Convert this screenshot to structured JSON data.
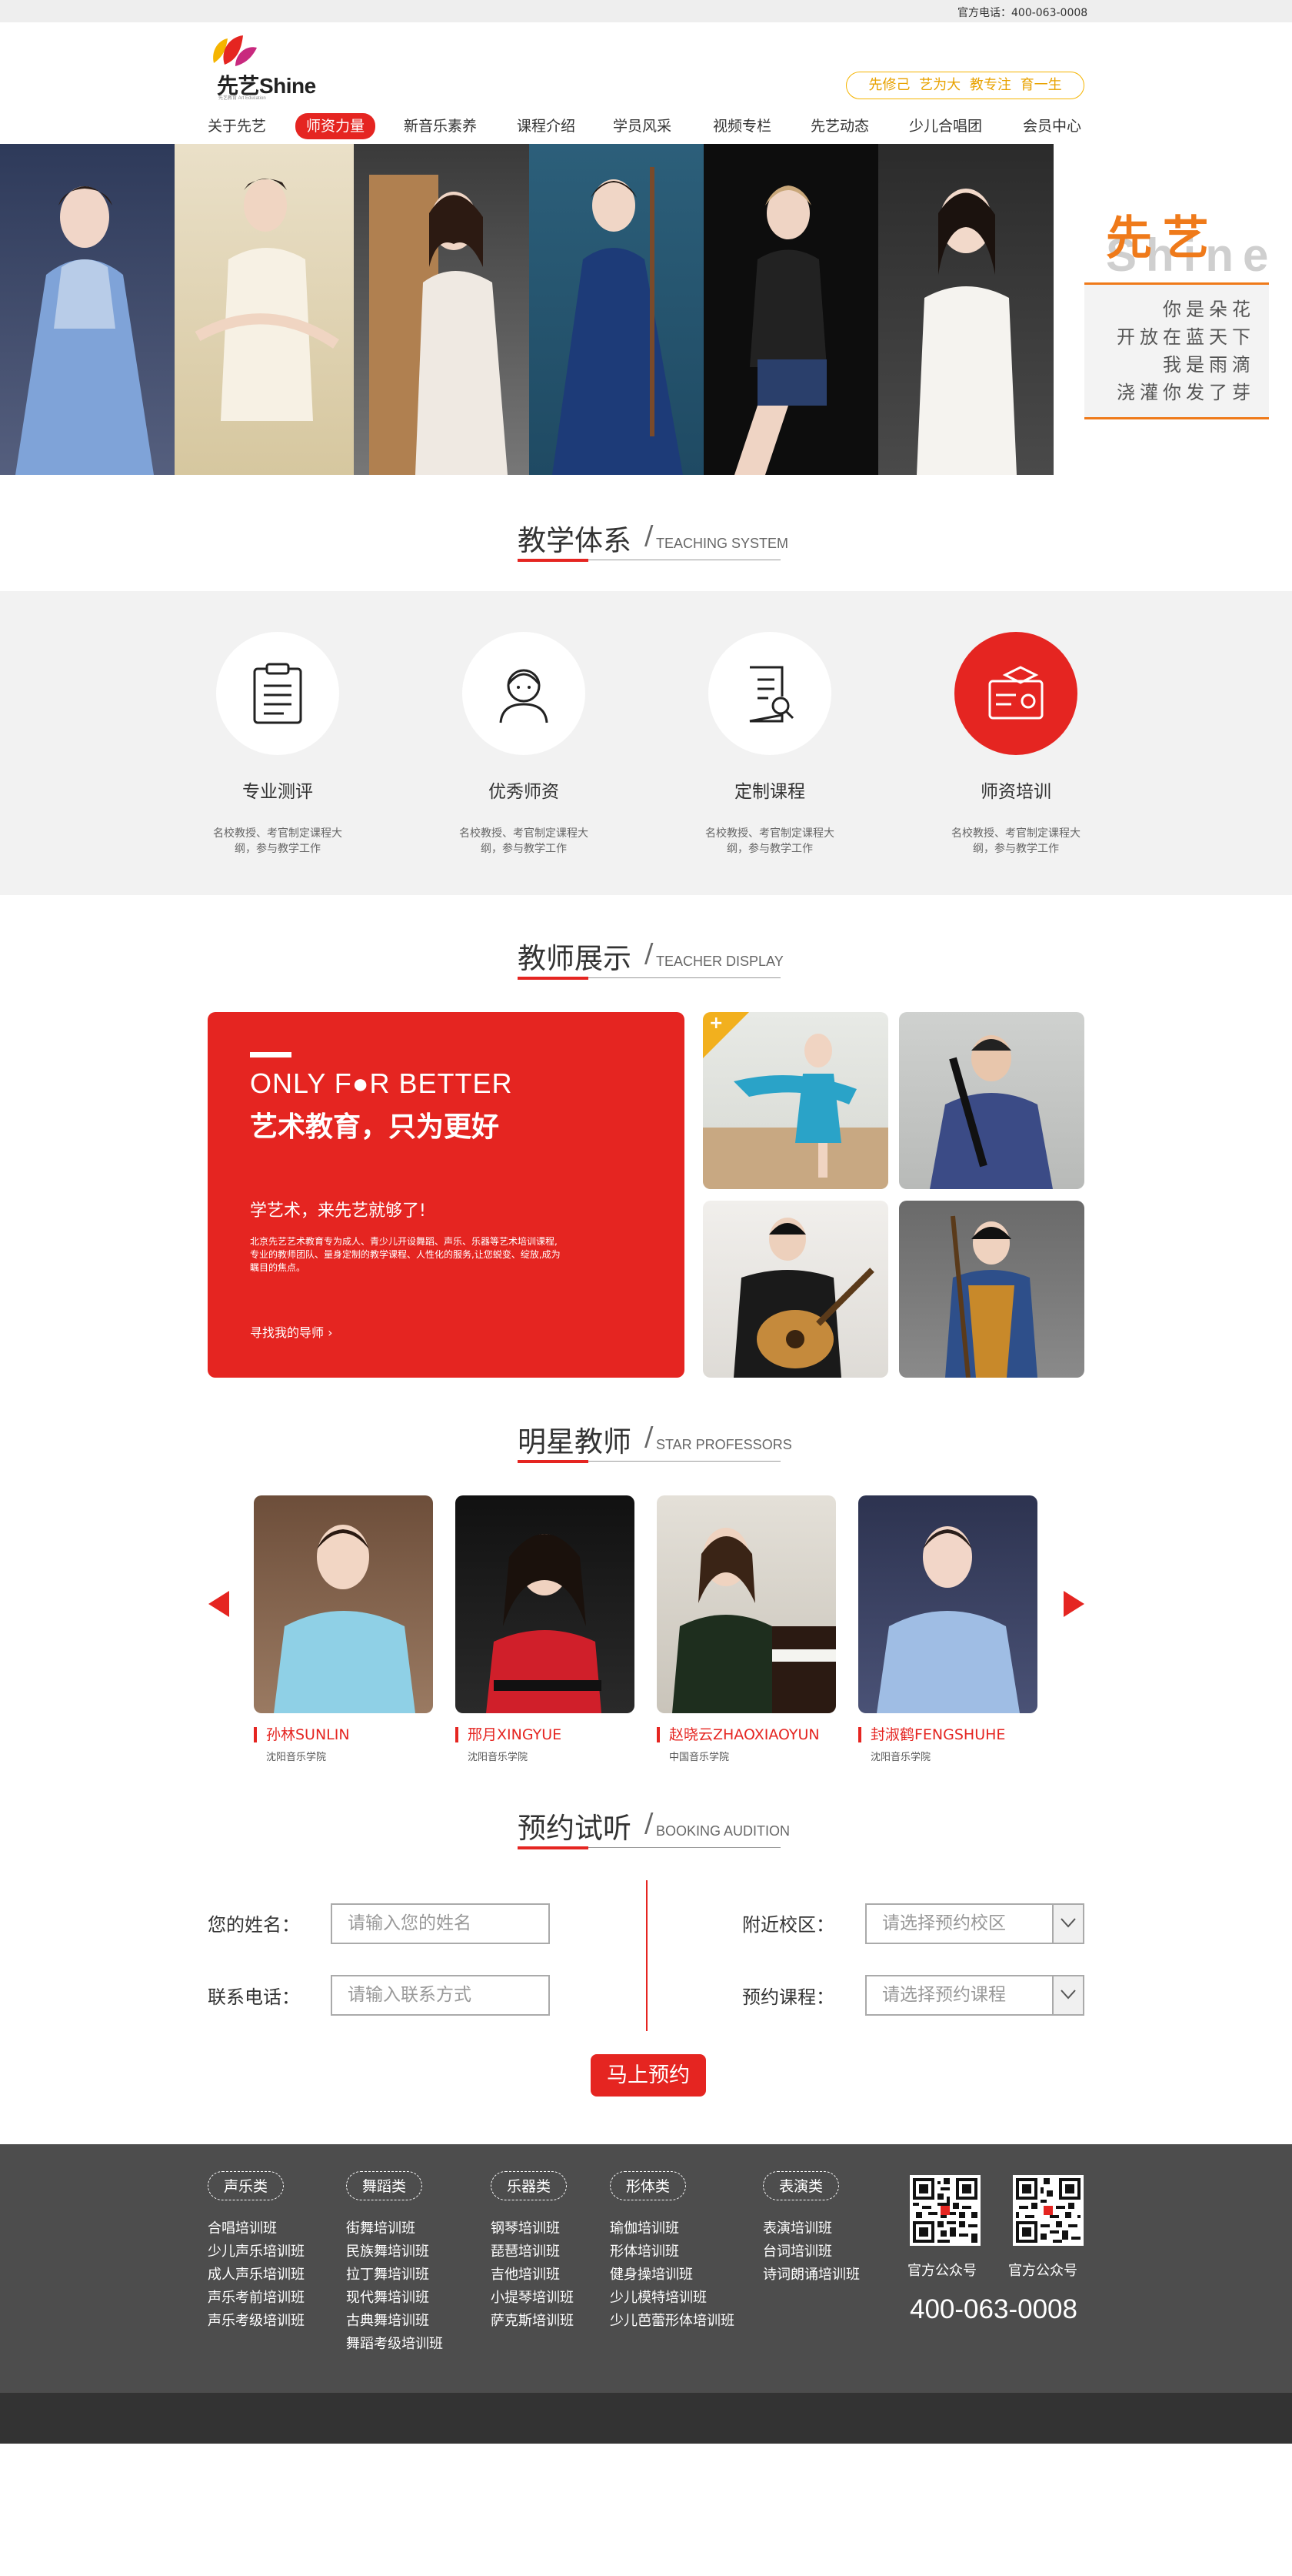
{
  "topbar": {
    "phone": "官方电话：400-063-0008"
  },
  "logo": {
    "text": "先艺Shine",
    "sub": "先艺教育 Art Education"
  },
  "slogan": "先修己 艺为大 教专注 育一生",
  "nav": [
    "关于先艺",
    "师资力量",
    "新音乐素养",
    "课程介绍",
    "学员风采",
    "视频专栏",
    "先艺动态",
    "少儿合唱团",
    "会员中心"
  ],
  "banner": {
    "brand": "先艺",
    "shine": "Shine",
    "poem": [
      "你是朵花",
      "开放在蓝天下",
      "我是雨滴",
      "浇灌你发了芽"
    ]
  },
  "sections": {
    "teaching": {
      "cn": "教学体系",
      "en": "TEACHING SYSTEM"
    },
    "display": {
      "cn": "教师展示",
      "en": "TEACHER DISPLAY"
    },
    "stars": {
      "cn": "明星教师",
      "en": "STAR PROFESSORS"
    },
    "booking": {
      "cn": "预约试听",
      "en": "BOOKING AUDITION"
    }
  },
  "system": [
    {
      "title": "专业测评",
      "desc": "名校教授、考官制定课程大纲，参与教学工作",
      "icon": "clipboard-icon"
    },
    {
      "title": "优秀师资",
      "desc": "名校教授、考官制定课程大纲，参与教学工作",
      "icon": "teacher-icon"
    },
    {
      "title": "定制课程",
      "desc": "名校教授、考官制定课程大纲，参与教学工作",
      "icon": "document-search-icon"
    },
    {
      "title": "师资培训",
      "desc": "名校教授、考官制定课程大纲，参与教学工作",
      "icon": "certificate-icon"
    }
  ],
  "display": {
    "en": "ONLY F●R BETTER",
    "cn": "艺术教育，只为更好",
    "sub": "学艺术，来先艺就够了!",
    "desc": "北京先艺艺术教育专为成人、青少儿开设舞蹈、声乐、乐器等艺术培训课程,专业的教师团队、量身定制的教学课程、人性化的服务,让您蜕变、绽放,成为瞩目的焦点。",
    "find": "寻找我的导师 ›"
  },
  "stars": [
    {
      "name": "孙林SUNLIN",
      "school": "沈阳音乐学院"
    },
    {
      "name": "邢月XINGYUE",
      "school": "沈阳音乐学院"
    },
    {
      "name": "赵晓云ZHAOXIAOYUN",
      "school": "中国音乐学院"
    },
    {
      "name": "封淑鹤FENGSHUHE",
      "school": "沈阳音乐学院"
    }
  ],
  "booking": {
    "name_label": "您的姓名：",
    "name_ph": "请输入您的姓名",
    "phone_label": "联系电话：",
    "phone_ph": "请输入联系方式",
    "campus_label": "附近校区：",
    "campus_ph": "请选择预约校区",
    "course_label": "预约课程：",
    "course_ph": "请选择预约课程",
    "submit": "马上预约"
  },
  "footer": {
    "cats": [
      {
        "tag": "声乐类",
        "items": [
          "合唱培训班",
          "少儿声乐培训班",
          "成人声乐培训班",
          "声乐考前培训班",
          "声乐考级培训班"
        ]
      },
      {
        "tag": "舞蹈类",
        "items": [
          "街舞培训班",
          "民族舞培训班",
          "拉丁舞培训班",
          "现代舞培训班",
          "古典舞培训班",
          "舞蹈考级培训班"
        ]
      },
      {
        "tag": "乐器类",
        "items": [
          "钢琴培训班",
          "琵琶培训班",
          "吉他培训班",
          "小提琴培训班",
          "萨克斯培训班"
        ]
      },
      {
        "tag": "形体类",
        "items": [
          "瑜伽培训班",
          "形体培训班",
          "健身操培训班",
          "少儿模特培训班",
          "少儿芭蕾形体培训班"
        ]
      },
      {
        "tag": "表演类",
        "items": [
          "表演培训班",
          "台词培训班",
          "诗词朗诵培训班"
        ]
      }
    ],
    "qr1": "官方公众号",
    "qr2": "官方公众号",
    "hotline": "400-063-0008"
  },
  "colors": {
    "accent": "#e52521",
    "orange": "#ef7a1a",
    "footer": "#4d4d4d"
  }
}
